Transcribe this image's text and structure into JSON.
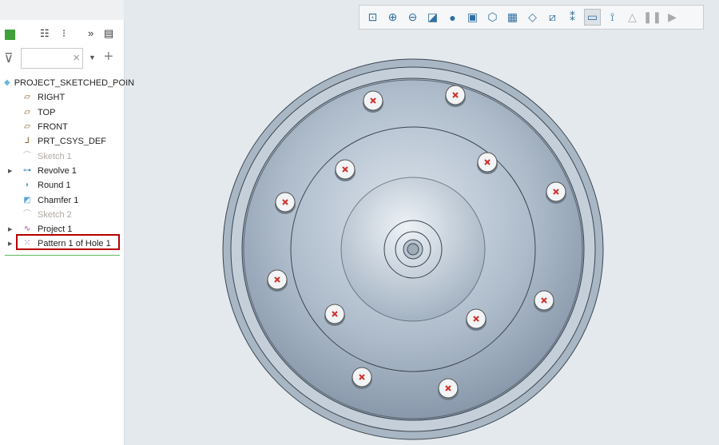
{
  "panel": {
    "filter_value": "",
    "filter_clear": "×",
    "tree": [
      {
        "label": "PROJECT_SKETCHED_POIN",
        "icon": "part-icon",
        "level": 0,
        "dim": false,
        "expand": false
      },
      {
        "label": "RIGHT",
        "icon": "datum-plane-icon",
        "level": 1,
        "dim": false,
        "expand": false
      },
      {
        "label": "TOP",
        "icon": "datum-plane-icon",
        "level": 1,
        "dim": false,
        "expand": false
      },
      {
        "label": "FRONT",
        "icon": "datum-plane-icon",
        "level": 1,
        "dim": false,
        "expand": false
      },
      {
        "label": "PRT_CSYS_DEF",
        "icon": "csys-icon",
        "level": 1,
        "dim": false,
        "expand": false
      },
      {
        "label": "Sketch 1",
        "icon": "sketch-icon",
        "level": 1,
        "dim": true,
        "expand": false
      },
      {
        "label": "Revolve 1",
        "icon": "revolve-icon",
        "level": 1,
        "dim": false,
        "expand": true
      },
      {
        "label": "Round 1",
        "icon": "round-icon",
        "level": 1,
        "dim": false,
        "expand": false
      },
      {
        "label": "Chamfer 1",
        "icon": "chamfer-icon",
        "level": 1,
        "dim": false,
        "expand": false
      },
      {
        "label": "Sketch 2",
        "icon": "sketch-icon",
        "level": 1,
        "dim": true,
        "expand": false
      },
      {
        "label": "Project 1",
        "icon": "project-icon",
        "level": 1,
        "dim": false,
        "expand": true
      },
      {
        "label": "Pattern 1 of Hole 1",
        "icon": "pattern-icon",
        "level": 1,
        "dim": false,
        "expand": true,
        "selected": true
      }
    ]
  },
  "toolbar": [
    "refit-icon",
    "zoom-in-icon",
    "zoom-out-icon",
    "repaint-icon",
    "display-style-icon",
    "saved-orientations-icon",
    "named-views-icon",
    "view-manager-icon",
    "perspective-icon",
    "section-icon",
    "datum-display-icon",
    "annotation-display-icon",
    "spin-center-icon",
    "appearance-icon",
    "pause-icon",
    "next-icon"
  ],
  "colors": {
    "selection": "#b50000",
    "hole_mark": "#d0302a",
    "part": "#a9b8c8"
  }
}
